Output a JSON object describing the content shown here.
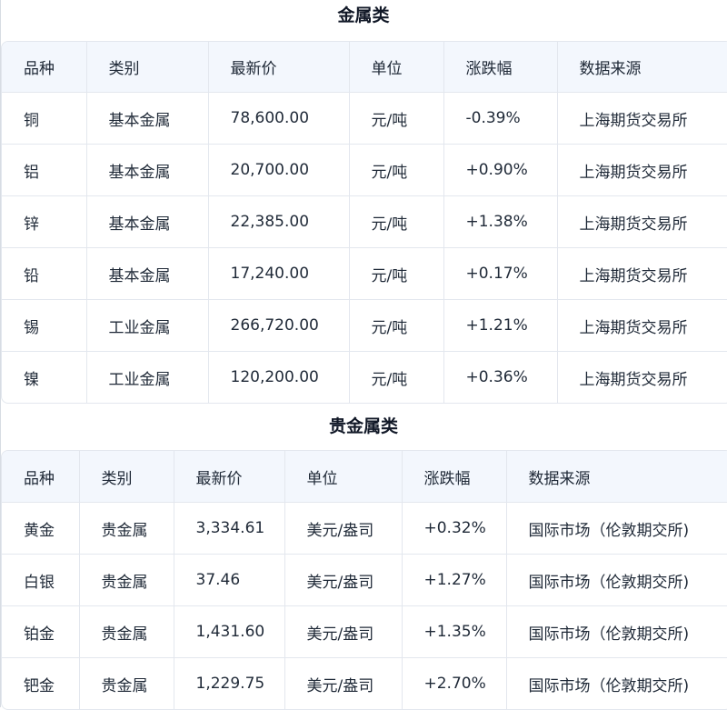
{
  "metals": {
    "title": "金属类",
    "columns": [
      "品种",
      "类别",
      "最新价",
      "单位",
      "涨跌幅",
      "数据来源"
    ],
    "rows": [
      [
        "铜",
        "基本金属",
        "78,600.00",
        "元/吨",
        "-0.39%",
        "上海期货交易所"
      ],
      [
        "铝",
        "基本金属",
        "20,700.00",
        "元/吨",
        "+0.90%",
        "上海期货交易所"
      ],
      [
        "锌",
        "基本金属",
        "22,385.00",
        "元/吨",
        "+1.38%",
        "上海期货交易所"
      ],
      [
        "铅",
        "基本金属",
        "17,240.00",
        "元/吨",
        "+0.17%",
        "上海期货交易所"
      ],
      [
        "锡",
        "工业金属",
        "266,720.00",
        "元/吨",
        "+1.21%",
        "上海期货交易所"
      ],
      [
        "镍",
        "工业金属",
        "120,200.00",
        "元/吨",
        "+0.36%",
        "上海期货交易所"
      ]
    ]
  },
  "precious": {
    "title": "贵金属类",
    "columns": [
      "品种",
      "类别",
      "最新价",
      "单位",
      "涨跌幅",
      "数据来源"
    ],
    "rows": [
      [
        "黄金",
        "贵金属",
        "3,334.61",
        "美元/盎司",
        "+0.32%",
        "国际市场（伦敦期交所)"
      ],
      [
        "白银",
        "贵金属",
        "37.46",
        "美元/盎司",
        "+1.27%",
        "国际市场（伦敦期交所)"
      ],
      [
        "铂金",
        "贵金属",
        "1,431.60",
        "美元/盎司",
        "+1.35%",
        "国际市场（伦敦期交所)"
      ],
      [
        "钯金",
        "贵金属",
        "1,229.75",
        "美元/盎司",
        "+2.70%",
        "国际市场（伦敦期交所)"
      ]
    ]
  }
}
